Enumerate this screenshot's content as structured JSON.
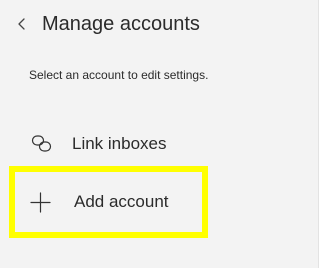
{
  "header": {
    "back_icon": "chevron-left-icon",
    "title": "Manage accounts"
  },
  "description": "Select an account to edit settings.",
  "items": [
    {
      "icon": "link-icon",
      "label": "Link inboxes"
    },
    {
      "icon": "plus-icon",
      "label": "Add account"
    }
  ],
  "colors": {
    "panel_background": "#f3f3f3",
    "highlight": "#ffff00",
    "text": "#2b2b2b"
  }
}
